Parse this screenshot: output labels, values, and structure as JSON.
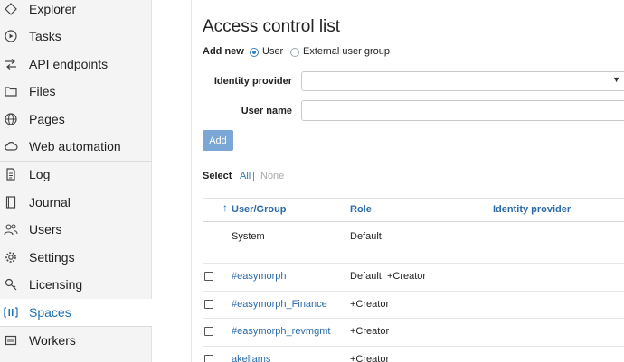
{
  "sidebar": {
    "items": [
      {
        "label": "Explorer",
        "icon": "explorer-icon"
      },
      {
        "label": "Tasks",
        "icon": "tasks-play-icon"
      },
      {
        "label": "API endpoints",
        "icon": "api-endpoints-icon"
      },
      {
        "label": "Files",
        "icon": "folder-icon"
      },
      {
        "label": "Pages",
        "icon": "globe-icon"
      },
      {
        "label": "Web automation",
        "icon": "cloud-icon"
      },
      {
        "label": "Log",
        "icon": "log-document-icon"
      },
      {
        "label": "Journal",
        "icon": "journal-book-icon"
      },
      {
        "label": "Users",
        "icon": "users-icon"
      },
      {
        "label": "Settings",
        "icon": "gear-icon"
      },
      {
        "label": "Licensing",
        "icon": "key-icon"
      },
      {
        "label": "Spaces",
        "icon": "spaces-icon",
        "active": true
      },
      {
        "label": "Workers",
        "icon": "workers-icon"
      }
    ]
  },
  "main": {
    "title": "Access control list",
    "add_new": {
      "label": "Add new",
      "options": [
        {
          "label": "User",
          "checked": true
        },
        {
          "label": "External user group",
          "checked": false
        }
      ]
    },
    "identity_provider": {
      "label": "Identity provider",
      "value": ""
    },
    "user_name": {
      "label": "User name",
      "value": ""
    },
    "add_button": "Add",
    "select": {
      "label": "Select",
      "all": "All",
      "separator": "|",
      "none": "None"
    },
    "table": {
      "sort_arrow": "↑",
      "columns": [
        "User/Group",
        "Role",
        "Identity provider"
      ],
      "rows": [
        {
          "checkbox": false,
          "user": "System",
          "role": "Default",
          "provider": "",
          "link": false
        },
        {
          "checkbox": true,
          "user": "#easymorph",
          "role": "Default, +Creator",
          "provider": "",
          "link": true
        },
        {
          "checkbox": true,
          "user": "#easymorph_Finance",
          "role": "+Creator",
          "provider": "",
          "link": true
        },
        {
          "checkbox": true,
          "user": "#easymorph_revmgmt",
          "role": "+Creator",
          "provider": "",
          "link": true
        },
        {
          "checkbox": true,
          "user": "akellams",
          "role": "+Creator",
          "provider": "",
          "link": true
        }
      ]
    }
  },
  "colors": {
    "accent": "#1f6fb2",
    "link": "#2a6aa8",
    "button": "#7aa7d6",
    "sidebar_bg": "#f4f4f4"
  }
}
